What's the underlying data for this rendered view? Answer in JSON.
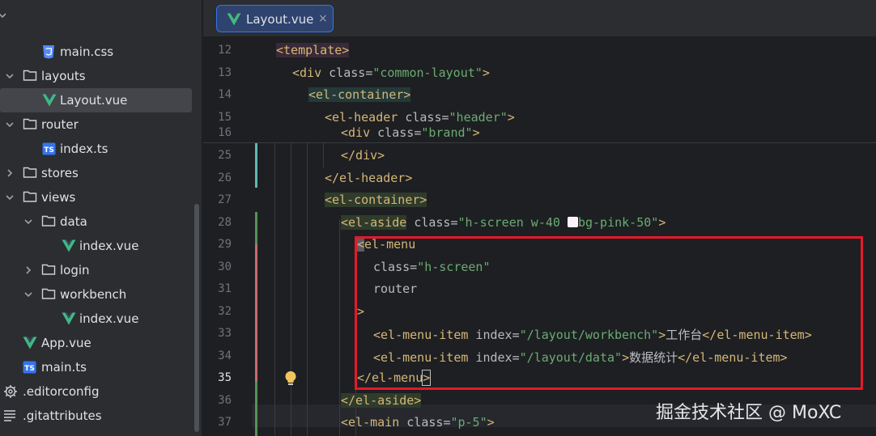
{
  "tree": {
    "items": [
      {
        "label": "main.css",
        "icon": "css-file-icon"
      },
      {
        "label": "layouts",
        "icon": "folder-icon"
      },
      {
        "label": "Layout.vue",
        "icon": "vue-file-icon"
      },
      {
        "label": "router",
        "icon": "folder-icon"
      },
      {
        "label": "index.ts",
        "icon": "ts-file-icon"
      },
      {
        "label": "stores",
        "icon": "folder-icon"
      },
      {
        "label": "views",
        "icon": "folder-icon"
      },
      {
        "label": "data",
        "icon": "folder-icon"
      },
      {
        "label": "index.vue",
        "icon": "vue-file-icon"
      },
      {
        "label": "login",
        "icon": "folder-icon"
      },
      {
        "label": "workbench",
        "icon": "folder-icon"
      },
      {
        "label": "index.vue",
        "icon": "vue-file-icon"
      },
      {
        "label": "App.vue",
        "icon": "vue-file-icon"
      },
      {
        "label": "main.ts",
        "icon": "ts-file-icon"
      },
      {
        "label": ".editorconfig",
        "icon": "gear-icon"
      },
      {
        "label": ".gitattributes",
        "icon": "lines-icon"
      }
    ]
  },
  "tab": {
    "label": "Layout.vue",
    "close": "×"
  },
  "lines": {
    "n12": "12",
    "n13": "13",
    "n14": "14",
    "n15": "15",
    "n16": "16",
    "n25": "25",
    "n26": "26",
    "n27": "27",
    "n28": "28",
    "n29": "29",
    "n30": "30",
    "n31": "31",
    "n32": "32",
    "n33": "33",
    "n34": "34",
    "n35": "35",
    "n36": "36",
    "n37": "37"
  },
  "code": {
    "template_open": "<template>",
    "div_open": "<div",
    "class_attr": "class",
    "common_layout": "\"common-layout\"",
    "gt": ">",
    "el_container_open": "<el-container>",
    "el_header_open": "<el-header",
    "header_val": "\"header\"",
    "brand_val": "\"brand\"",
    "div_close": "</div>",
    "el_header_close": "</el-header>",
    "el_container2": "<el-container>",
    "el_aside_open": "<el-aside",
    "aside_val_a": "\"h-screen w-40 ",
    "aside_val_b": "bg-pink-50\"",
    "menu_lt": "<",
    "el_menu_name": "el-menu",
    "class_eq": "class",
    "h_screen": "\"h-screen\"",
    "router": "router",
    "close_gt": ">",
    "menu_item_open": "<el-menu-item",
    "index_attr": "index",
    "workbench_path": "\"/layout/workbench\"",
    "workbench_text": "工作台",
    "menu_item_close": "</el-menu-item>",
    "data_path": "\"/layout/data\"",
    "data_text": "数据统计",
    "el_menu_close_a": "</el-menu",
    "el_menu_close_b": ">",
    "el_aside_close": "</el-aside>",
    "el_main_open": "<el-main",
    "p5_val": "\"p-5\""
  },
  "watermark": "掘金技术社区 @ MoXC",
  "colors": {
    "sidebar_bg": "#2b2d30",
    "editor_bg": "#1e1f22",
    "tag": "#d5b778",
    "string": "#6aab73",
    "highlight_box": "#e5192a",
    "vue_green": "#41b883"
  }
}
